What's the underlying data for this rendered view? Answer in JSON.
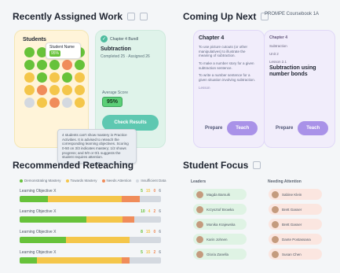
{
  "headers": {
    "recently_assigned": "Recently Assigned Work",
    "coming_up_next": "Coming Up Next",
    "recommended_reteaching": "Recommended Reteaching",
    "student_focus": "Student Focus",
    "top_badge": "PROMPE Coursebook 1A"
  },
  "recent": {
    "students_title": "Students",
    "student_hover_name": "Student Name",
    "student_hover_badge": "95%",
    "students_dots": [
      "green",
      "green",
      "yellow",
      "yellow",
      "green",
      "green",
      "green",
      "green",
      "orange",
      "green",
      "yellow",
      "green",
      "yellow",
      "green",
      "yellow",
      "yellow",
      "orange",
      "yellow",
      "yellow",
      "yellow",
      "gray",
      "yellow",
      "orange",
      "gray",
      "yellow"
    ],
    "assignment": {
      "chip": "Chapter 4 Bundl",
      "title": "Subtraction",
      "meta": "Completed 25 · Assigned 26",
      "avg_label": "Average Score",
      "avg_value": "95%",
      "check_results": "Check Results"
    },
    "tooltip": "4 students can't show mastery in Practice Activities. It is advised to reteach the corresponding learning objectives. Scoring 0-50 on 3/3 indicates mastery; 1/2 shows progress; and 0/0 or 0/1 suggests the student requires attention."
  },
  "coming": {
    "left_card": {
      "title": "Chapter 4",
      "desc_1": "To use picture cutouts (or other manipulatives) to illustrate the meaning of subtraction.",
      "desc_2": "To make a number story for a given subtraction sentence.",
      "desc_3": "To write a number sentence for a given situation involving subtraction.",
      "link": "Lesson",
      "prepare": "Prepare",
      "teach": "Teach"
    },
    "right_card": {
      "chip": "Chapter 4",
      "subtitle": "Subtraction",
      "unit": "Unit 2",
      "lesson": "Lesson 2.1",
      "title": "Subtraction using number bonds",
      "prepare": "Prepare",
      "teach": "Teach"
    }
  },
  "reteaching": {
    "legend": [
      {
        "label": "Demonstrating Mastery",
        "color": "#67c23a"
      },
      {
        "label": "Towards Mastery",
        "color": "#f4c64a"
      },
      {
        "label": "Needs Attention",
        "color": "#f08c5a"
      },
      {
        "label": "Insufficient Data",
        "color": "#d4d9e0"
      }
    ],
    "objectives": [
      {
        "name": "Learning Objective X",
        "counts": [
          "5",
          "15",
          "0",
          "6"
        ],
        "segments": [
          {
            "color": "#67c23a",
            "w": 20
          },
          {
            "color": "#f4c64a",
            "w": 52
          },
          {
            "color": "#f08c5a",
            "w": 13
          },
          {
            "color": "#d4d9e0",
            "w": 15
          }
        ]
      },
      {
        "name": "Learning Objective X",
        "counts": [
          "10",
          "4",
          "2",
          "6"
        ],
        "segments": [
          {
            "color": "#67c23a",
            "w": 47
          },
          {
            "color": "#f4c64a",
            "w": 26
          },
          {
            "color": "#f08c5a",
            "w": 8
          },
          {
            "color": "#d4d9e0",
            "w": 19
          }
        ]
      },
      {
        "name": "Learning Objective X",
        "counts": [
          "8",
          "15",
          "0",
          "6"
        ],
        "segments": [
          {
            "color": "#67c23a",
            "w": 33
          },
          {
            "color": "#f4c64a",
            "w": 45
          },
          {
            "color": "#d4d9e0",
            "w": 22
          }
        ]
      },
      {
        "name": "Learning Objective X",
        "counts": [
          "5",
          "15",
          "2",
          "6"
        ],
        "segments": [
          {
            "color": "#67c23a",
            "w": 12
          },
          {
            "color": "#f4c64a",
            "w": 60
          },
          {
            "color": "#f08c5a",
            "w": 6
          },
          {
            "color": "#d4d9e0",
            "w": 22
          }
        ]
      }
    ]
  },
  "focus": {
    "leaders_title": "Leaders",
    "attention_title": "Needing Attention",
    "leaders": [
      "Magda Barsuik",
      "Krzysztof Browka",
      "Monika Krajewska",
      "Karin Johnen",
      "Gloria Zanella"
    ],
    "attention": [
      "Sabine Klein",
      "Brett Gasser",
      "Brett Gasser",
      "Dante Postassana",
      "Susan Chen"
    ]
  },
  "colors": {
    "green": "#67c23a",
    "yellow": "#f4c64a",
    "orange": "#f08c5a",
    "gray": "#d4d9e0",
    "purple": "#a992e8",
    "teal": "#5ec8b1"
  }
}
